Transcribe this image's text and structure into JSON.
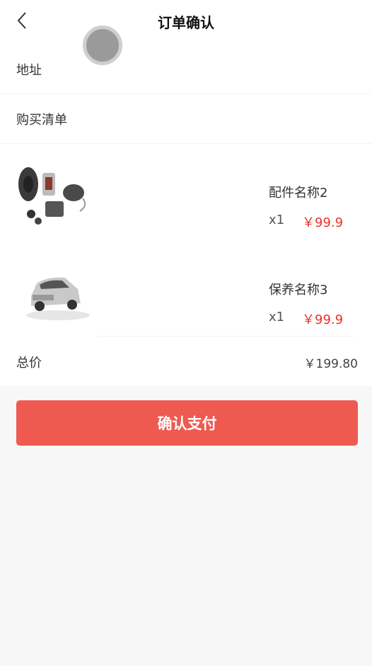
{
  "header": {
    "title": "订单确认",
    "back_icon": "chevron-left-icon"
  },
  "address": {
    "label": "地址"
  },
  "list": {
    "label": "购买清单"
  },
  "items": [
    {
      "name": "配件名称2",
      "qty": "x1",
      "price": "￥99.9",
      "image": "car-audio-speakers"
    },
    {
      "name": "保养名称3",
      "qty": "x1",
      "price": "￥99.9",
      "image": "white-suv"
    }
  ],
  "total": {
    "label": "总价",
    "value": "￥199.80"
  },
  "pay_button": {
    "label": "确认支付"
  },
  "colors": {
    "accent": "#ee5a4f",
    "price": "#e8332a",
    "background": "#f7f7f7"
  }
}
